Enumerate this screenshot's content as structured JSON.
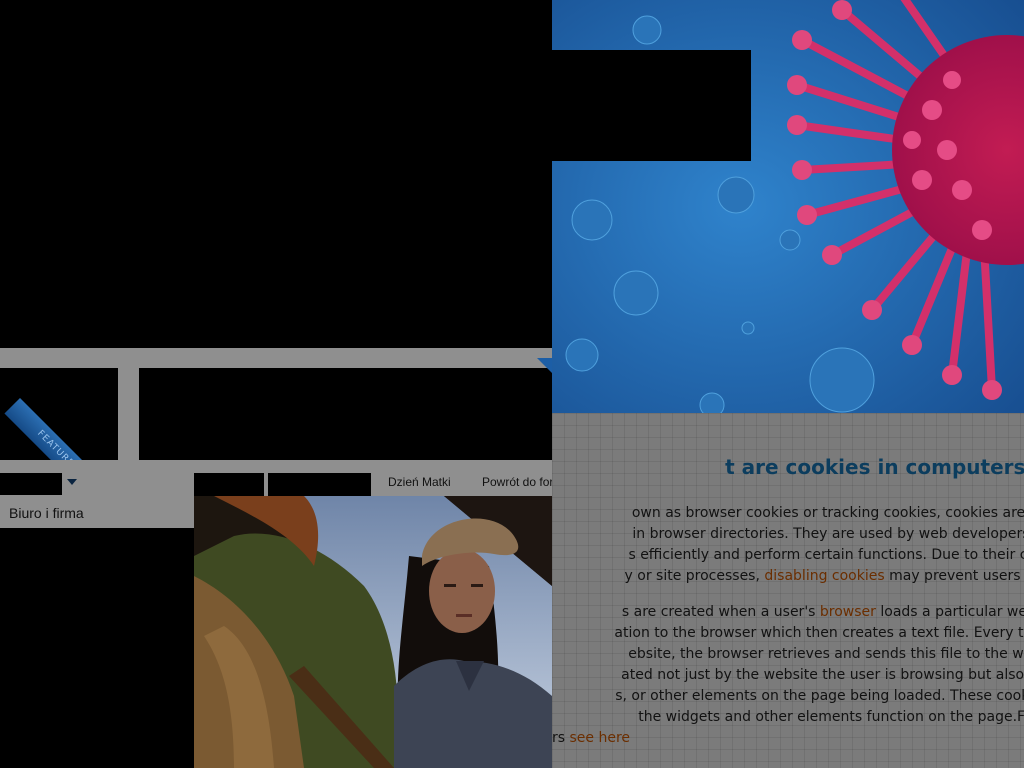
{
  "left_page": {
    "featured_label": "FEATURED",
    "nav": {
      "items": [
        "Dzień Matki",
        "Powrót do for"
      ]
    },
    "side_menu": {
      "item": "Biuro i firma"
    }
  },
  "article": {
    "title": "t are cookies in computers?",
    "paragraph1": {
      "line1": "own as browser cookies or tracking cookies, cookies are small, often",
      "line2": "in browser directories. They are used by web developers to help use",
      "line3": "s efficiently and perform certain functions. Due to their core role of e",
      "line4_before": "y or site processes, ",
      "line4_link": "disabling cookies",
      "line4_after": " may prevent users from using c"
    },
    "paragraph2": {
      "line1_before": "s are created when a user's ",
      "line1_link": "browser",
      "line1_after": " loads a particular website. The w",
      "line2": "ation to the browser which then creates a text file. Every time the user",
      "line3": "ebsite, the browser retrieves and sends this file to the website's serv",
      "line4": "ated not just by the website the user is browsing but also by other we",
      "line5": "s, or other elements on the page being loaded. These cookies regulate",
      "line6": "the widgets and other elements function on the page.For Managing",
      "line7_before": "rs ",
      "line7_link": "see here"
    }
  },
  "colors": {
    "title": "#0c3d5e",
    "link": "#6b2e00",
    "overlay_gray": "#8f8f8f",
    "ribbon": "#1c5ea6"
  }
}
